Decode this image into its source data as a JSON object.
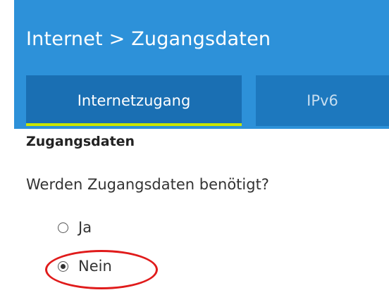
{
  "header": {
    "breadcrumb": "Internet > Zugangsdaten"
  },
  "tabs": [
    {
      "label": "Internetzugang",
      "active": true
    },
    {
      "label": "IPv6",
      "active": false
    }
  ],
  "section": {
    "title": "Zugangsdaten",
    "question": "Werden Zugangsdaten benötigt?"
  },
  "options": [
    {
      "label": "Ja",
      "selected": false
    },
    {
      "label": "Nein",
      "selected": true
    }
  ],
  "colors": {
    "header_bg": "#2d91d9",
    "tab_active_bg": "#1a6fb3",
    "tab_indicator": "#c9e600",
    "highlight": "#e01b1b"
  }
}
